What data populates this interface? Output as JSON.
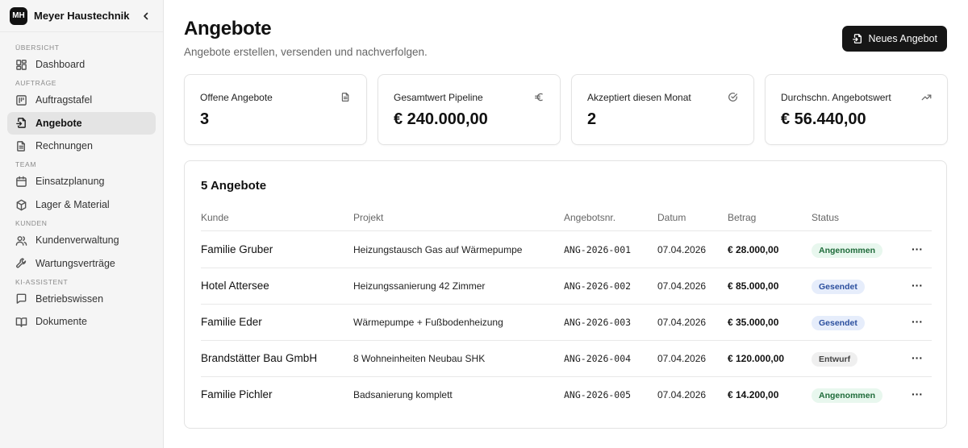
{
  "brand": {
    "initials": "MH",
    "name": "Meyer Haustechnik"
  },
  "sidebar": {
    "sections": [
      {
        "label": "ÜBERSICHT",
        "items": [
          {
            "label": "Dashboard",
            "icon": "dashboard-icon"
          }
        ]
      },
      {
        "label": "AUFTRÄGE",
        "items": [
          {
            "label": "Auftragstafel",
            "icon": "board-icon"
          },
          {
            "label": "Angebote",
            "icon": "quote-icon",
            "active": true
          },
          {
            "label": "Rechnungen",
            "icon": "invoice-icon"
          }
        ]
      },
      {
        "label": "TEAM",
        "items": [
          {
            "label": "Einsatzplanung",
            "icon": "calendar-icon"
          },
          {
            "label": "Lager & Material",
            "icon": "package-icon"
          }
        ]
      },
      {
        "label": "KUNDEN",
        "items": [
          {
            "label": "Kundenverwaltung",
            "icon": "users-icon"
          },
          {
            "label": "Wartungsverträge",
            "icon": "wrench-icon"
          }
        ]
      },
      {
        "label": "KI-ASSISTENT",
        "items": [
          {
            "label": "Betriebswissen",
            "icon": "chat-icon"
          },
          {
            "label": "Dokumente",
            "icon": "book-icon"
          }
        ]
      }
    ]
  },
  "header": {
    "title": "Angebote",
    "subtitle": "Angebote erstellen, versenden und nachverfolgen.",
    "new_button": "Neues Angebot"
  },
  "stats": [
    {
      "label": "Offene Angebote",
      "value": "3",
      "icon": "document-icon"
    },
    {
      "label": "Gesamtwert Pipeline",
      "value": "€ 240.000,00",
      "icon": "euro-icon"
    },
    {
      "label": "Akzeptiert diesen Monat",
      "value": "2",
      "icon": "check-circle-icon"
    },
    {
      "label": "Durchschn. Angebotswert",
      "value": "€ 56.440,00",
      "icon": "trending-up-icon"
    }
  ],
  "table": {
    "title": "5 Angebote",
    "columns": {
      "kunde": "Kunde",
      "projekt": "Projekt",
      "nr": "Angebotsnr.",
      "datum": "Datum",
      "betrag": "Betrag",
      "status": "Status"
    },
    "rows": [
      {
        "kunde": "Familie Gruber",
        "projekt": "Heizungstausch Gas auf Wärmepumpe",
        "nr": "ANG-2026-001",
        "datum": "07.04.2026",
        "betrag": "€ 28.000,00",
        "status": "Angenommen",
        "status_type": "akzeptiert"
      },
      {
        "kunde": "Hotel Attersee",
        "projekt": "Heizungssanierung 42 Zimmer",
        "nr": "ANG-2026-002",
        "datum": "07.04.2026",
        "betrag": "€ 85.000,00",
        "status": "Gesendet",
        "status_type": "gesendet"
      },
      {
        "kunde": "Familie Eder",
        "projekt": "Wärmepumpe + Fußbodenheizung",
        "nr": "ANG-2026-003",
        "datum": "07.04.2026",
        "betrag": "€ 35.000,00",
        "status": "Gesendet",
        "status_type": "gesendet"
      },
      {
        "kunde": "Brandstätter Bau GmbH",
        "projekt": "8 Wohneinheiten Neubau SHK",
        "nr": "ANG-2026-004",
        "datum": "07.04.2026",
        "betrag": "€ 120.000,00",
        "status": "Entwurf",
        "status_type": "entwurf"
      },
      {
        "kunde": "Familie Pichler",
        "projekt": "Badsanierung komplett",
        "nr": "ANG-2026-005",
        "datum": "07.04.2026",
        "betrag": "€ 14.200,00",
        "status": "Angenommen",
        "status_type": "akzeptiert"
      }
    ]
  }
}
